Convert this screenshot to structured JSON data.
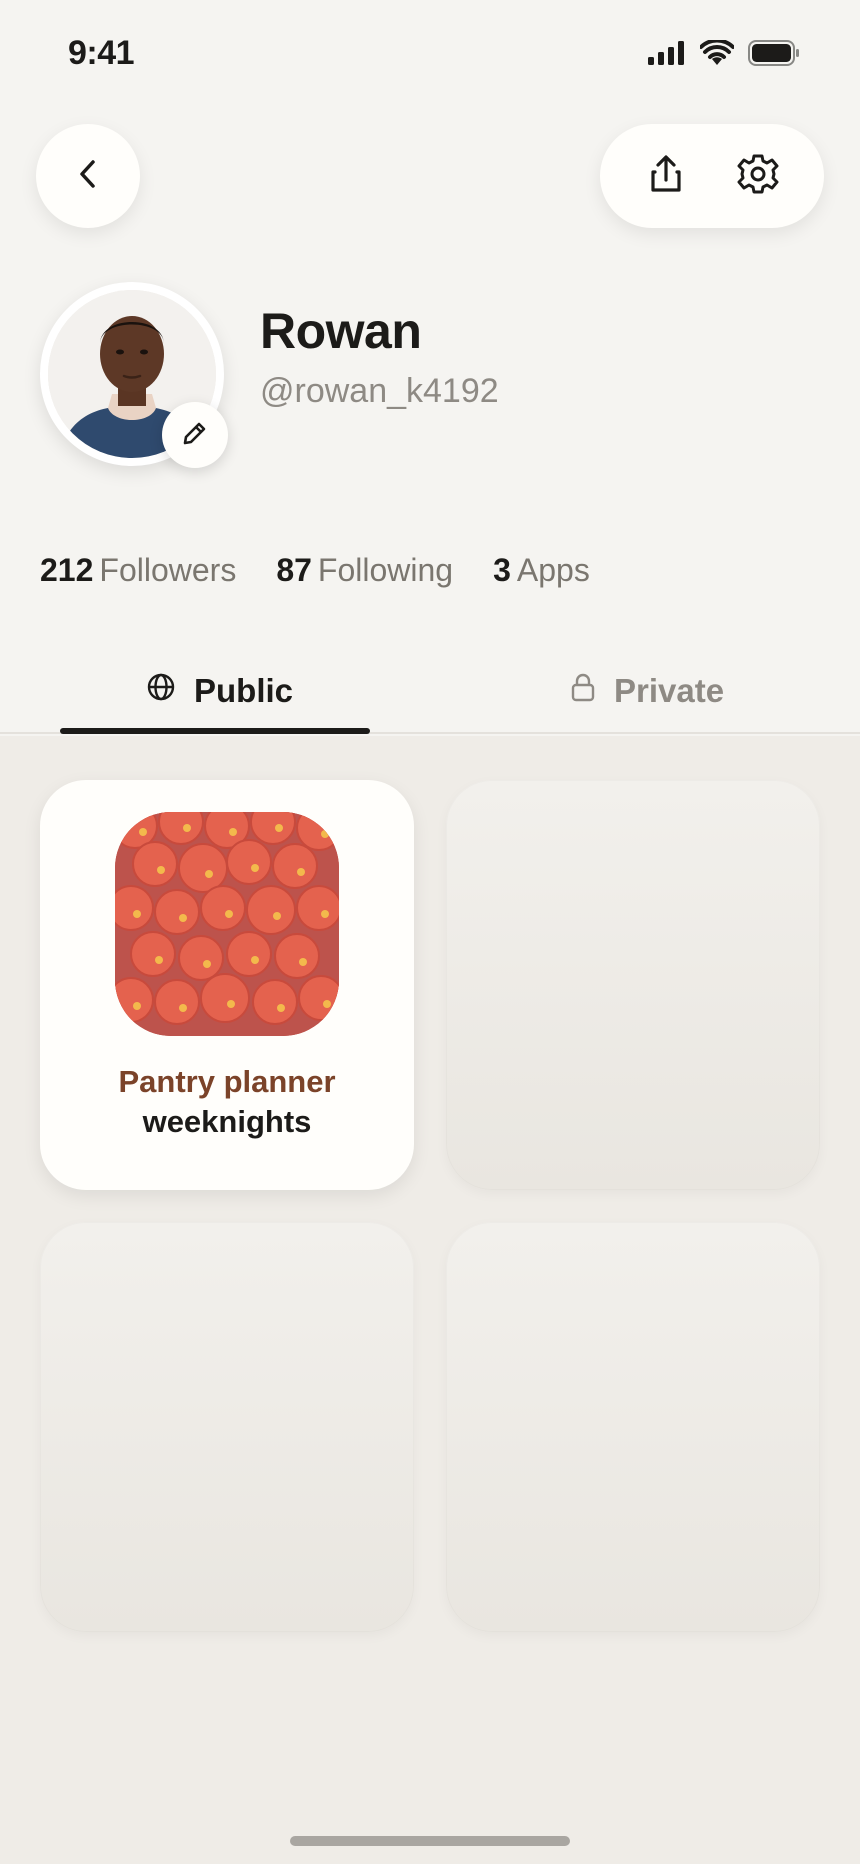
{
  "status_bar": {
    "time": "9:41"
  },
  "header": {
    "back_icon": "chevron-left-icon",
    "share_icon": "share-icon",
    "settings_icon": "gear-icon"
  },
  "profile": {
    "display_name": "Rowan",
    "username": "@rowan_k4192",
    "edit_icon": "pencil-icon"
  },
  "stats": [
    {
      "count": "212",
      "label": "Followers"
    },
    {
      "count": "87",
      "label": "Following"
    },
    {
      "count": "3",
      "label": "Apps"
    }
  ],
  "tabs": [
    {
      "label": "Public",
      "icon": "globe-icon",
      "selected": true
    },
    {
      "label": "Private",
      "icon": "lock-icon",
      "selected": false
    }
  ],
  "apps": [
    {
      "title_line1": "Pantry planner",
      "title_line2": "weeknights"
    }
  ],
  "colors": {
    "background": "#f5f4f1",
    "grid_background": "#efece7",
    "text_primary": "#1c1b19",
    "text_secondary": "#8e8a84",
    "app_title_accent": "#7b4329"
  }
}
